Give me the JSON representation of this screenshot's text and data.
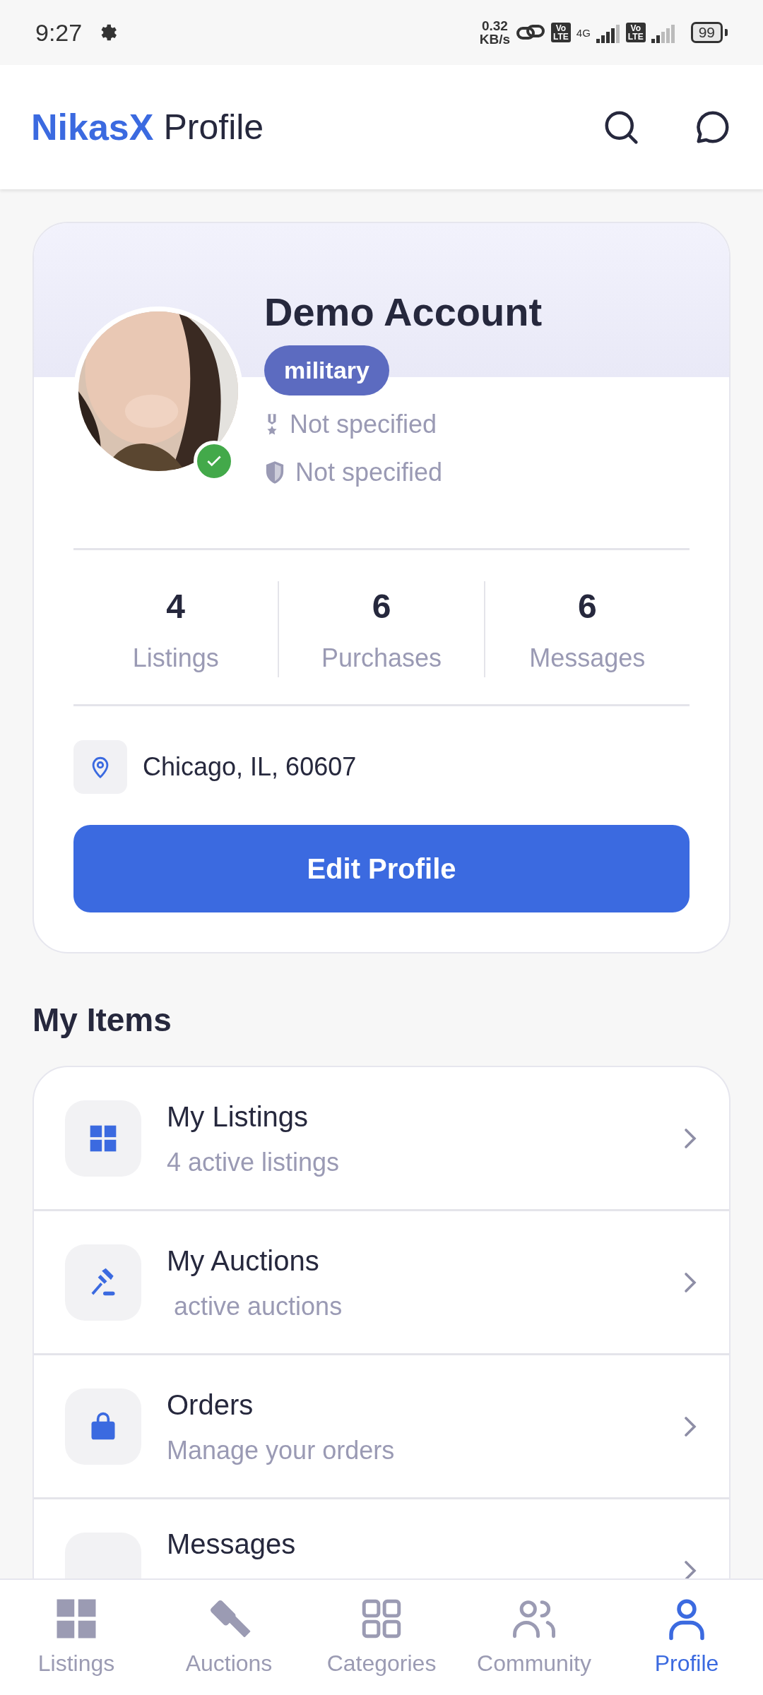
{
  "status_bar": {
    "time": "9:27",
    "speed": "0.32",
    "speed_unit": "KB/s",
    "sim_badges": [
      {
        "top": "Vo",
        "bottom": "LTE"
      },
      {
        "top": "Vo",
        "bottom": "LTE"
      }
    ],
    "network": "4G",
    "battery": "99"
  },
  "header": {
    "brand": "NikasX",
    "title": "Profile"
  },
  "profile": {
    "name": "Demo Account",
    "verified": true,
    "tag": "military",
    "details": [
      "Not specified",
      "Not specified"
    ],
    "stats": [
      {
        "value": "4",
        "label": "Listings"
      },
      {
        "value": "6",
        "label": "Purchases"
      },
      {
        "value": "6",
        "label": "Messages"
      }
    ],
    "location": "Chicago, IL, 60607",
    "edit_button": "Edit Profile"
  },
  "section_title": "My Items",
  "items": [
    {
      "title": "My Listings",
      "subtitle": "4 active listings"
    },
    {
      "title": "My Auctions",
      "subtitle": " active auctions"
    },
    {
      "title": "Orders",
      "subtitle": "Manage your orders"
    },
    {
      "title": "Messages"
    }
  ],
  "bottom_nav": [
    {
      "label": "Listings",
      "selected": false
    },
    {
      "label": "Auctions",
      "selected": false
    },
    {
      "label": "Categories",
      "selected": false
    },
    {
      "label": "Community",
      "selected": false
    },
    {
      "label": "Profile",
      "selected": true
    }
  ]
}
